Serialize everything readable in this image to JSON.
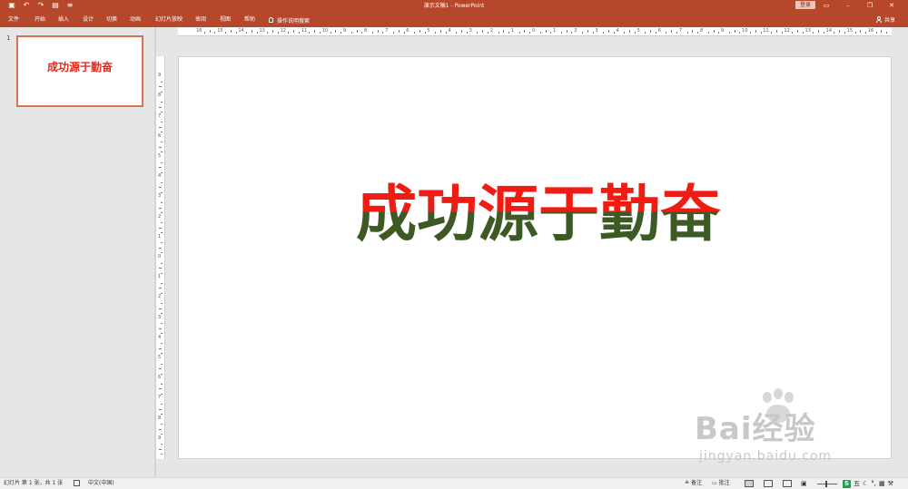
{
  "app": {
    "window_title": "演示文稿1  -  PowerPoint",
    "login_label": "登录",
    "share_label": "共享",
    "tell_me_label": "操作说明搜索"
  },
  "ribbon": {
    "tabs": [
      "文件",
      "开始",
      "插入",
      "设计",
      "切换",
      "动画",
      "幻灯片放映",
      "审阅",
      "视图",
      "帮助"
    ]
  },
  "thumbnails": [
    {
      "number": "1",
      "text": "成功源于勤奋"
    }
  ],
  "slide": {
    "title": "成功源于勤奋",
    "title_colors": {
      "top": "#ee1c12",
      "bottom": "#3e5a24"
    }
  },
  "ruler": {
    "horizontal_labels": [
      "16",
      "15",
      "14",
      "13",
      "12",
      "11",
      "10",
      "9",
      "8",
      "7",
      "6",
      "5",
      "4",
      "3",
      "2",
      "1",
      "0",
      "1",
      "2",
      "3",
      "4",
      "5",
      "6",
      "7",
      "8",
      "9",
      "10",
      "11",
      "12",
      "13",
      "14",
      "15",
      "16"
    ],
    "vertical_labels": [
      "9",
      "8",
      "7",
      "6",
      "5",
      "4",
      "3",
      "2",
      "1",
      "0",
      "1",
      "2",
      "3",
      "4",
      "5",
      "6",
      "7",
      "8",
      "9"
    ]
  },
  "status": {
    "slide_info": "幻灯片 第 1 张，共 1 张",
    "language": "中文(中国)",
    "notes_label": "备注",
    "comments_label": "批注",
    "ime_label": "五"
  },
  "watermark": {
    "brand": "Bai经验",
    "url": "jingyan.baidu.com"
  },
  "colors": {
    "accent": "#b7472a",
    "thumb_border": "#d9714f"
  }
}
